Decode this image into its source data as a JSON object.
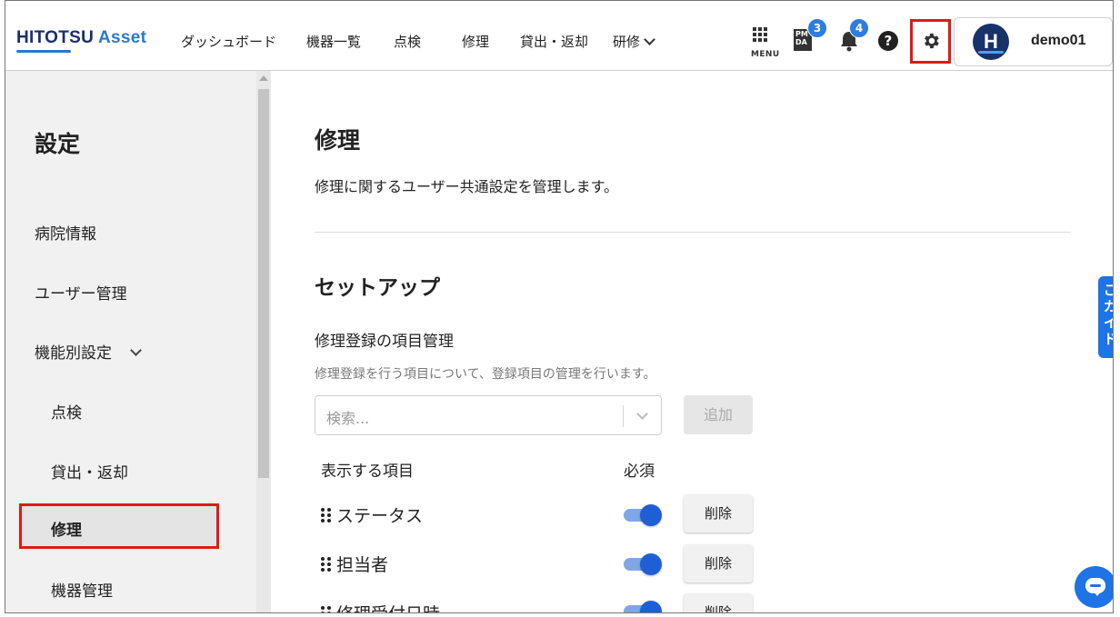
{
  "app": {
    "logo_main": "HITOTSU ",
    "logo_accent": "Asset"
  },
  "nav": {
    "items": [
      "ダッシュボード",
      "機器一覧",
      "点検",
      "修理",
      "貸出・返却"
    ],
    "dropdown_label": "研修",
    "menu_label": "MENU",
    "pmda_badge": "3",
    "pmda_icon_text_top": "PM",
    "pmda_icon_text_bottom": "DA",
    "bell_badge": "4",
    "help_glyph": "?"
  },
  "user": {
    "initial": "H",
    "name": "demo01"
  },
  "sidebar": {
    "title": "設定",
    "items": [
      "病院情報",
      "ユーザー管理",
      "機能別設定"
    ],
    "sub_items": [
      "点検",
      "貸出・返却",
      "修理",
      "機器管理"
    ],
    "active": "修理"
  },
  "main": {
    "title": "修理",
    "description": "修理に関するユーザー共通設定を管理します。",
    "section_title": "セットアップ",
    "sub_title": "修理登録の項目管理",
    "sub_desc": "修理登録を行う項目について、登録項目の管理を行います。",
    "search_placeholder": "検索...",
    "add_label": "追加",
    "col_items": "表示する項目",
    "col_required": "必須",
    "rows": [
      {
        "label": "ステータス",
        "required": true,
        "delete_label": "削除"
      },
      {
        "label": "担当者",
        "required": true,
        "delete_label": "削除"
      },
      {
        "label": "修理受付日時",
        "required": true,
        "delete_label": "削除"
      }
    ]
  },
  "guide_tab": {
    "chars": [
      "ご",
      "ガ",
      "イ",
      "ド"
    ]
  },
  "colors": {
    "accent": "#1e73e6",
    "brand": "#1b2f6b",
    "highlight": "#e01919"
  }
}
